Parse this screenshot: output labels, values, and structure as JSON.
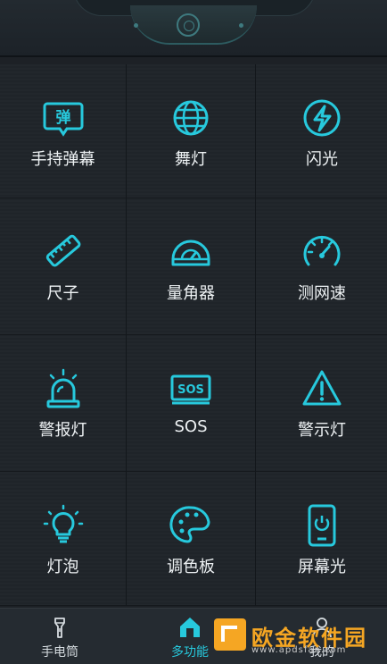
{
  "accent": "#27c9dd",
  "features": [
    {
      "label": "手持弹幕",
      "icon": "danmaku-bubble-icon",
      "glyph": "弹"
    },
    {
      "label": "舞灯",
      "icon": "disco-ball-icon"
    },
    {
      "label": "闪光",
      "icon": "flash-bolt-icon"
    },
    {
      "label": "尺子",
      "icon": "ruler-icon"
    },
    {
      "label": "量角器",
      "icon": "protractor-icon"
    },
    {
      "label": "测网速",
      "icon": "speedometer-icon"
    },
    {
      "label": "警报灯",
      "icon": "alarm-light-icon"
    },
    {
      "label": "SOS",
      "icon": "sos-sign-icon",
      "glyph": "SOS"
    },
    {
      "label": "警示灯",
      "icon": "warning-triangle-icon"
    },
    {
      "label": "灯泡",
      "icon": "light-bulb-icon"
    },
    {
      "label": "调色板",
      "icon": "palette-icon"
    },
    {
      "label": "屏幕光",
      "icon": "screen-light-phone-icon"
    }
  ],
  "tabs": [
    {
      "label": "手电筒",
      "icon": "flashlight-icon"
    },
    {
      "label": "多功能",
      "icon": "home-icon",
      "active": true
    },
    {
      "label": "我的",
      "icon": "profile-icon"
    }
  ],
  "watermark": {
    "title": "欧金软件园",
    "url": "www.apdsfan.com"
  }
}
